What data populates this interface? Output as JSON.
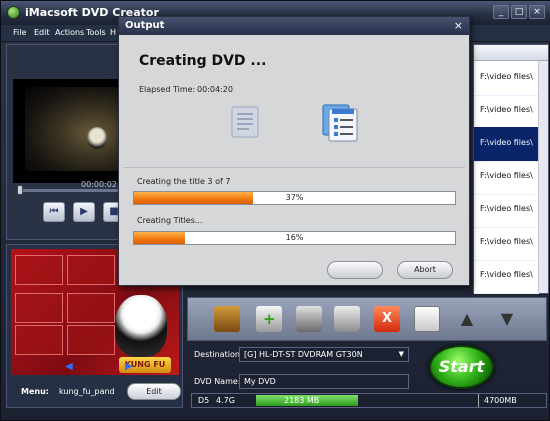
{
  "app": {
    "title": "iMacsoft DVD Creator",
    "window_buttons": [
      "_",
      "□",
      "×"
    ]
  },
  "menubar": {
    "items": [
      "File",
      "Edit",
      "Actions",
      "Tools",
      "H"
    ]
  },
  "preview": {
    "time_code": "00:00:02",
    "controls": [
      "⏮",
      "▶",
      "■"
    ]
  },
  "menu_panel": {
    "label": "Menu:",
    "value": "kung_fu_pand",
    "edit_label": "Edit",
    "logo_text": "KUNG FU"
  },
  "file_list": {
    "rows": [
      {
        "text": "F:\\video files\\",
        "selected": false
      },
      {
        "text": "F:\\video files\\",
        "selected": false
      },
      {
        "text": "F:\\video files\\",
        "selected": true
      },
      {
        "text": "F:\\video files\\",
        "selected": false
      },
      {
        "text": "F:\\video files\\",
        "selected": false
      },
      {
        "text": "F:\\video files\\",
        "selected": false
      },
      {
        "text": "F:\\video files\\",
        "selected": false
      }
    ]
  },
  "toolbar": {
    "buttons": [
      "add-video",
      "add-folder",
      "edit",
      "delete",
      "remove",
      "settings",
      "move-up",
      "move-down"
    ]
  },
  "output": {
    "destination_label": "Destination:",
    "destination_value": "[G] HL-DT-ST DVDRAM GT30N",
    "dvd_name_label": "DVD Name:",
    "dvd_name_value": "My DVD",
    "start_label": "Start",
    "disc_type": "D5",
    "disc_size": "4.7G",
    "used": "2183 MB",
    "used_fraction": 0.46,
    "capacity": "4700MB"
  },
  "dialog": {
    "title": "Output",
    "close": "×",
    "heading": "Creating DVD ...",
    "elapsed_label": "Elapsed Time:",
    "elapsed_value": "00:04:20",
    "status1": "Creating the title 3 of 7",
    "progress1_text": "37%",
    "progress1_value": 0.37,
    "status2": "Creating Titles...",
    "progress2_text": "16%",
    "progress2_value": 0.16,
    "button1_label": "",
    "abort_label": "Abort"
  }
}
